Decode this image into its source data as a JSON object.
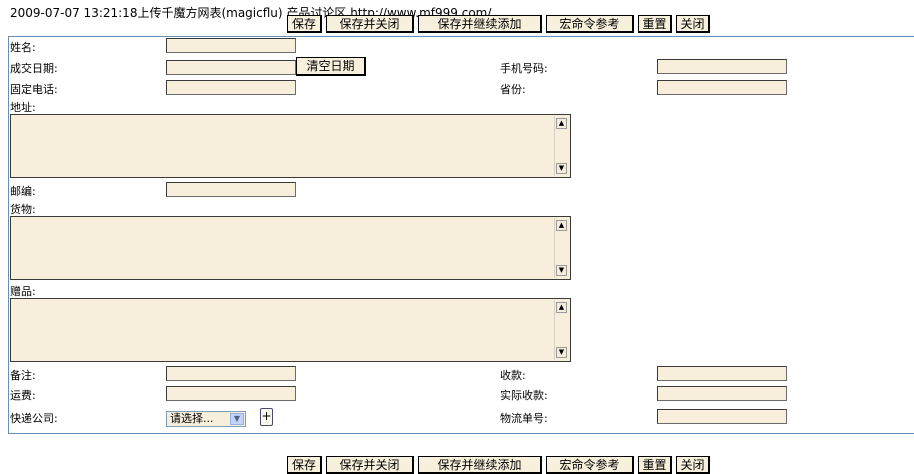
{
  "header": {
    "title": "2009-07-07 13:21:18上传千魔方网表(magicflu) 产品讨论区 http://www.mf999.com/"
  },
  "toolbar": {
    "save": "保存",
    "save_close": "保存并关闭",
    "save_continue": "保存并继续添加",
    "macro_ref": "宏命令参考",
    "reset": "重置",
    "close": "关闭"
  },
  "form": {
    "name_label": "姓名:",
    "deal_date_label": "成交日期:",
    "clear_date_button": "清空日期",
    "mobile_label": "手机号码:",
    "phone_label": "固定电话:",
    "province_label": "省份:",
    "address_label": "地址:",
    "postcode_label": "邮编:",
    "goods_label": "货物:",
    "gift_label": "赠品:",
    "remark_label": "备注:",
    "payment_label": "收款:",
    "freight_label": "运费:",
    "actual_payment_label": "实际收款:",
    "courier_label": "快递公司:",
    "courier_select_value": "请选择...",
    "add_button": "+",
    "tracking_label": "物流单号:"
  }
}
